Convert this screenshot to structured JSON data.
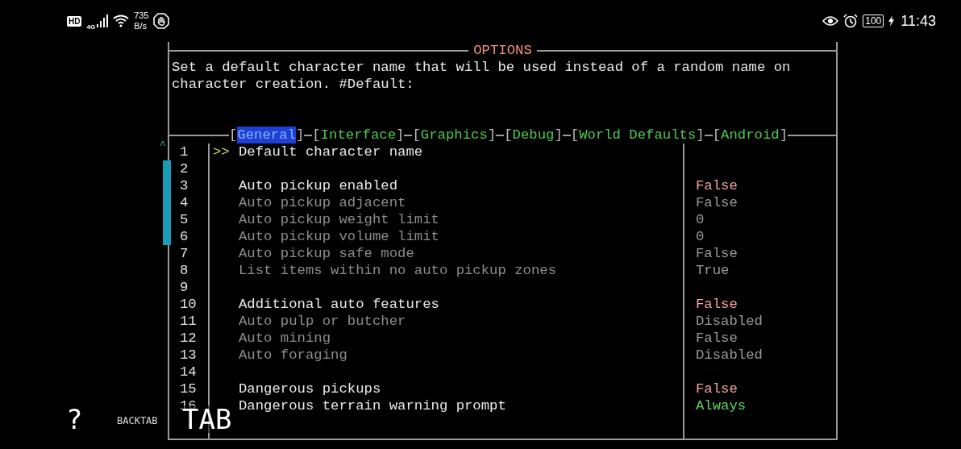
{
  "status_bar": {
    "hd": "HD",
    "network": "4G",
    "speed": "735",
    "speed_unit": "B/s",
    "battery": "100",
    "time": "11:43"
  },
  "window": {
    "title": "OPTIONS"
  },
  "description": [
    "Set a default character name that will be used instead of a random name on",
    "character creation. #Default:"
  ],
  "tab_brackets": [
    "[",
    "]"
  ],
  "tabs": [
    {
      "label": "General",
      "selected": true
    },
    {
      "label": "Interface",
      "selected": false
    },
    {
      "label": "Graphics",
      "selected": false
    },
    {
      "label": "Debug",
      "selected": false
    },
    {
      "label": "World Defaults",
      "selected": false
    },
    {
      "label": "Android",
      "selected": false
    }
  ],
  "scroll_up": "^",
  "cursor": ">>",
  "rows": [
    {
      "number": "1",
      "name": "Default character name",
      "kind": "header",
      "selected": true
    },
    {
      "number": "2",
      "selected": false
    },
    {
      "number": "3",
      "name": "Auto pickup enabled",
      "value": "False",
      "kind": "header",
      "color": "#f4a4a4",
      "selected": false
    },
    {
      "number": "4",
      "name": "Auto pickup adjacent",
      "value": "False",
      "kind": "option",
      "color": "#9a9a9a",
      "selected": false
    },
    {
      "number": "5",
      "name": "Auto pickup weight limit",
      "value": "0",
      "kind": "option",
      "color": "#9a9a9a",
      "selected": false
    },
    {
      "number": "6",
      "name": "Auto pickup volume limit",
      "value": "0",
      "kind": "option",
      "color": "#9a9a9a",
      "selected": false
    },
    {
      "number": "7",
      "name": "Auto pickup safe mode",
      "value": "False",
      "kind": "option",
      "color": "#9a9a9a",
      "selected": false
    },
    {
      "number": "8",
      "name": "List items within no auto pickup zones",
      "value": "True",
      "kind": "option",
      "color": "#9a9a9a",
      "selected": false
    },
    {
      "number": "9",
      "selected": false
    },
    {
      "number": "10",
      "name": "Additional auto features",
      "value": "False",
      "kind": "header",
      "color": "#f4a4a4",
      "selected": false
    },
    {
      "number": "11",
      "name": "Auto pulp or butcher",
      "value": "Disabled",
      "kind": "option",
      "color": "#9a9a9a",
      "selected": false
    },
    {
      "number": "12",
      "name": "Auto mining",
      "value": "False",
      "kind": "option",
      "color": "#9a9a9a",
      "selected": false
    },
    {
      "number": "13",
      "name": "Auto foraging",
      "value": "Disabled",
      "kind": "option",
      "color": "#9a9a9a",
      "selected": false
    },
    {
      "number": "14",
      "selected": false
    },
    {
      "number": "15",
      "name": "Dangerous pickups",
      "value": "False",
      "kind": "header",
      "color": "#f4a4a4",
      "selected": false
    },
    {
      "number": "16",
      "name": "Dangerous terrain warning prompt",
      "value": "Always",
      "kind": "header",
      "color": "#5fd35f",
      "selected": false
    }
  ],
  "overlay_buttons": [
    {
      "label": "?",
      "kind": "large"
    },
    {
      "label": "BACKTAB",
      "kind": "small"
    },
    {
      "label": "TAB",
      "kind": "large"
    }
  ]
}
